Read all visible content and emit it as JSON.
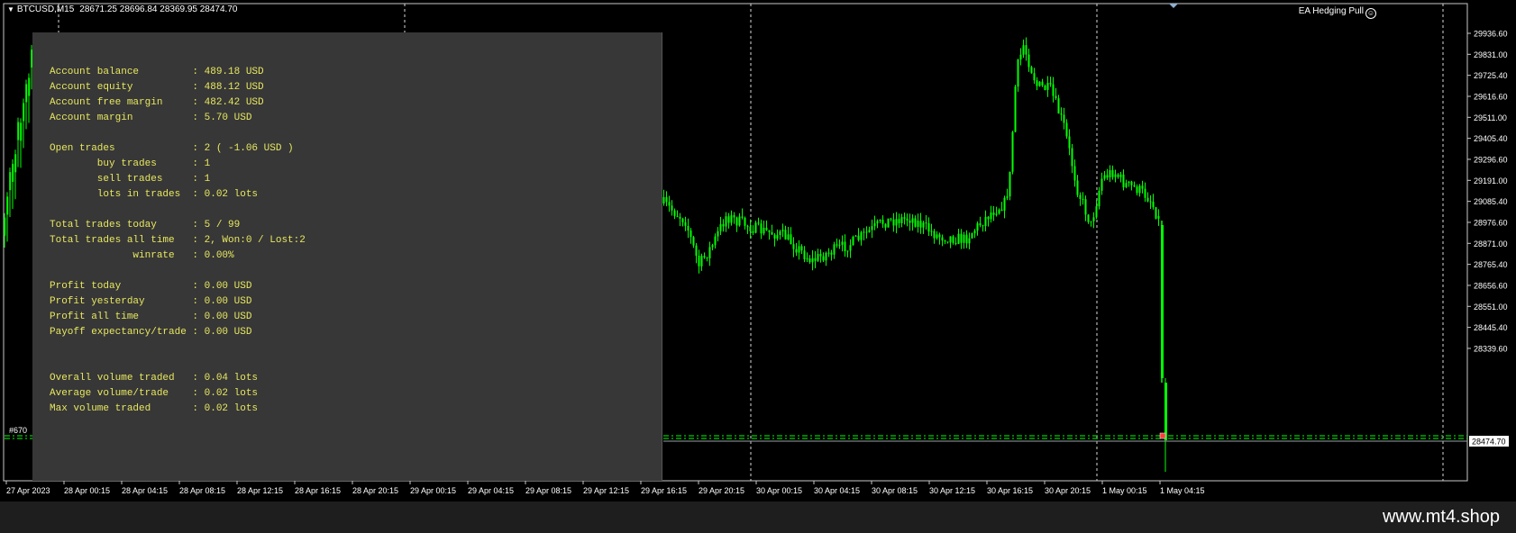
{
  "header": {
    "symbol_tf": "BTCUSD,M15",
    "ohlc": "28671.25 28696.84 28369.95 28474.70"
  },
  "ea_label": "EA Hedging Pull",
  "price_axis": {
    "labels": [
      "29936.60",
      "29831.00",
      "29725.40",
      "29616.60",
      "29511.00",
      "29405.40",
      "29296.60",
      "29191.00",
      "29085.40",
      "28976.60",
      "28871.00",
      "28765.40",
      "28656.60",
      "28551.00",
      "28445.40",
      "28339.60"
    ],
    "current_price": "28474.70"
  },
  "time_axis": {
    "labels": [
      "27 Apr 2023",
      "28 Apr 00:15",
      "28 Apr 04:15",
      "28 Apr 08:15",
      "28 Apr 12:15",
      "28 Apr 16:15",
      "28 Apr 20:15",
      "29 Apr 00:15",
      "29 Apr 04:15",
      "29 Apr 08:15",
      "29 Apr 12:15",
      "29 Apr 16:15",
      "29 Apr 20:15",
      "30 Apr 00:15",
      "30 Apr 04:15",
      "30 Apr 08:15",
      "30 Apr 12:15",
      "30 Apr 16:15",
      "30 Apr 20:15",
      "1 May 00:15",
      "1 May 04:15"
    ]
  },
  "panel": {
    "lines": [
      "Account balance         : 489.18 USD",
      "Account equity          : 488.12 USD",
      "Account free margin     : 482.42 USD",
      "Account margin          : 5.70 USD",
      "",
      "Open trades             : 2 ( -1.06 USD )",
      "        buy trades      : 1",
      "        sell trades     : 1",
      "        lots in trades  : 0.02 lots",
      "",
      "Total trades today      : 5 / 99",
      "Total trades all time   : 2, Won:0 / Lost:2",
      "              winrate   : 0.00%",
      "",
      "Profit today            : 0.00 USD",
      "Profit yesterday        : 0.00 USD",
      "Profit all time         : 0.00 USD",
      "Payoff expectancy/trade : 0.00 USD",
      "",
      "",
      "Overall volume traded   : 0.04 lots",
      "Average volume/trade    : 0.02 lots",
      "Max volume traded       : 0.02 lots"
    ]
  },
  "object_label": "#670",
  "footer": "www.mt4.shop",
  "colors": {
    "candle": "#00ff00",
    "panel_text": "#e8e860",
    "panel_bg": "#373737",
    "grid": "#ffffff"
  }
}
